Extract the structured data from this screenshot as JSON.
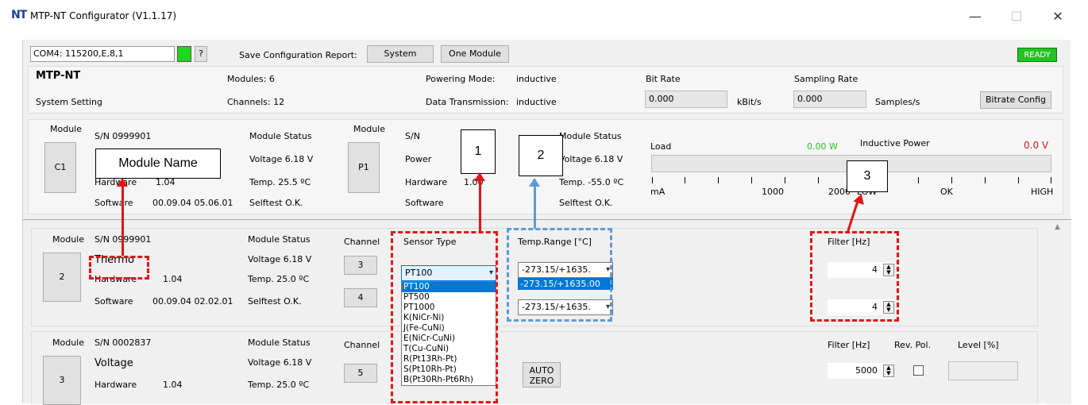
{
  "window": {
    "logo": "NT",
    "title": "MTP-NT Configurator (V1.1.17)",
    "minimize": "—",
    "maximize": "☐",
    "close": "✕"
  },
  "toolbar": {
    "com": "COM4: 115200,E,8,1",
    "help": "?",
    "save_label": "Save Configuration Report:",
    "system_btn": "System",
    "one_module_btn": "One Module",
    "status": "READY"
  },
  "system": {
    "name": "MTP-NT",
    "setting": "System Setting",
    "modules": "Modules: 6",
    "channels": "Channels: 12",
    "powering_label": "Powering Mode:",
    "powering_value": "inductive",
    "datatx_label": "Data Transmission:",
    "datatx_value": "inductive",
    "bitrate_label": "Bit Rate",
    "bitrate_value": "0.000",
    "bitrate_unit": "kBit/s",
    "sampling_label": "Sampling Rate",
    "sampling_value": "0.000",
    "sampling_unit": "Samples/s",
    "bitrate_btn": "Bitrate Config"
  },
  "c1": {
    "module": "Module",
    "btn": "C1",
    "sn": "S/N 0999901",
    "hardware": "Hardware",
    "hw_ver": "1.04",
    "software": "Software",
    "sw_ver": "00.09.04 05.06.01",
    "status": "Module Status",
    "voltage": "Voltage 6.18 V",
    "temp": "Temp.   25.5 ºC",
    "selftest": "Selftest O.K."
  },
  "p1": {
    "module": "Module",
    "btn": "P1",
    "sn": "S/N",
    "power": "Power",
    "hardware": "Hardware",
    "hw_ver": "1.00",
    "software": "Software",
    "status": "Module Status",
    "voltage": "Voltage 6.18 V",
    "temp": "Temp.   -55.0 ºC",
    "selftest": "Selftest O.K."
  },
  "load": {
    "label": "Load",
    "value": "0.00 W",
    "inductive": "Inductive Power",
    "power": "0.0  V",
    "ticks": [
      "mA",
      "1000",
      "2000",
      "LOW",
      "OK",
      "HIGH"
    ]
  },
  "m2": {
    "module": "Module",
    "btn": "2",
    "sn": "S/N 0999901",
    "name": "Thermo",
    "hardware": "Hardware",
    "hw_ver": "1.04",
    "software": "Software",
    "sw_ver": "00.09.04 02.02.01",
    "status": "Module Status",
    "voltage": "Voltage 6.18 V",
    "temp": "Temp.   25.0 ºC",
    "selftest": "Selftest O.K.",
    "channel": "Channel",
    "ch_a": "3",
    "ch_b": "4",
    "sensor_label": "Sensor Type",
    "sensor_value": "PT100",
    "range_label": "Temp.Range  [°C]",
    "range_value": "-273.15/+1635.",
    "range_selected": "-273.15/+1635.00",
    "range_value2": "-273.15/+1635.",
    "filter_label": "Filter [Hz]",
    "filter_a": "4",
    "filter_b": "4"
  },
  "sensor_options": [
    "PT100",
    "PT500",
    "PT1000",
    "K(NiCr-Ni)",
    "J(Fe-CuNi)",
    "E(NiCr-CuNi)",
    "T(Cu-CuNi)",
    "R(Pt13Rh-Pt)",
    "S(Pt10Rh-Pt)",
    "B(Pt30Rh-Pt6Rh)"
  ],
  "m3": {
    "module": "Module",
    "btn": "3",
    "sn": "S/N 0002837",
    "name": "Voltage",
    "hardware": "Hardware",
    "hw_ver": "1.04",
    "status": "Module Status",
    "voltage": "Voltage 6.18 V",
    "temp": "Temp.   25.0 ºC",
    "channel": "Channel",
    "ch_a": "5",
    "autozero": "AUTO ZERO",
    "filter_label": "Filter [Hz]",
    "filter_value": "5000",
    "revpol": "Rev. Pol.",
    "level": "Level  [%]"
  },
  "callouts": {
    "name": "Module Name",
    "one": "1",
    "two": "2",
    "three": "3"
  },
  "colors": {
    "accent_red": "#e31515",
    "accent_blue": "#5b9bd5",
    "ready_bg": "#22c322",
    "ind_green": "#00cc00"
  }
}
